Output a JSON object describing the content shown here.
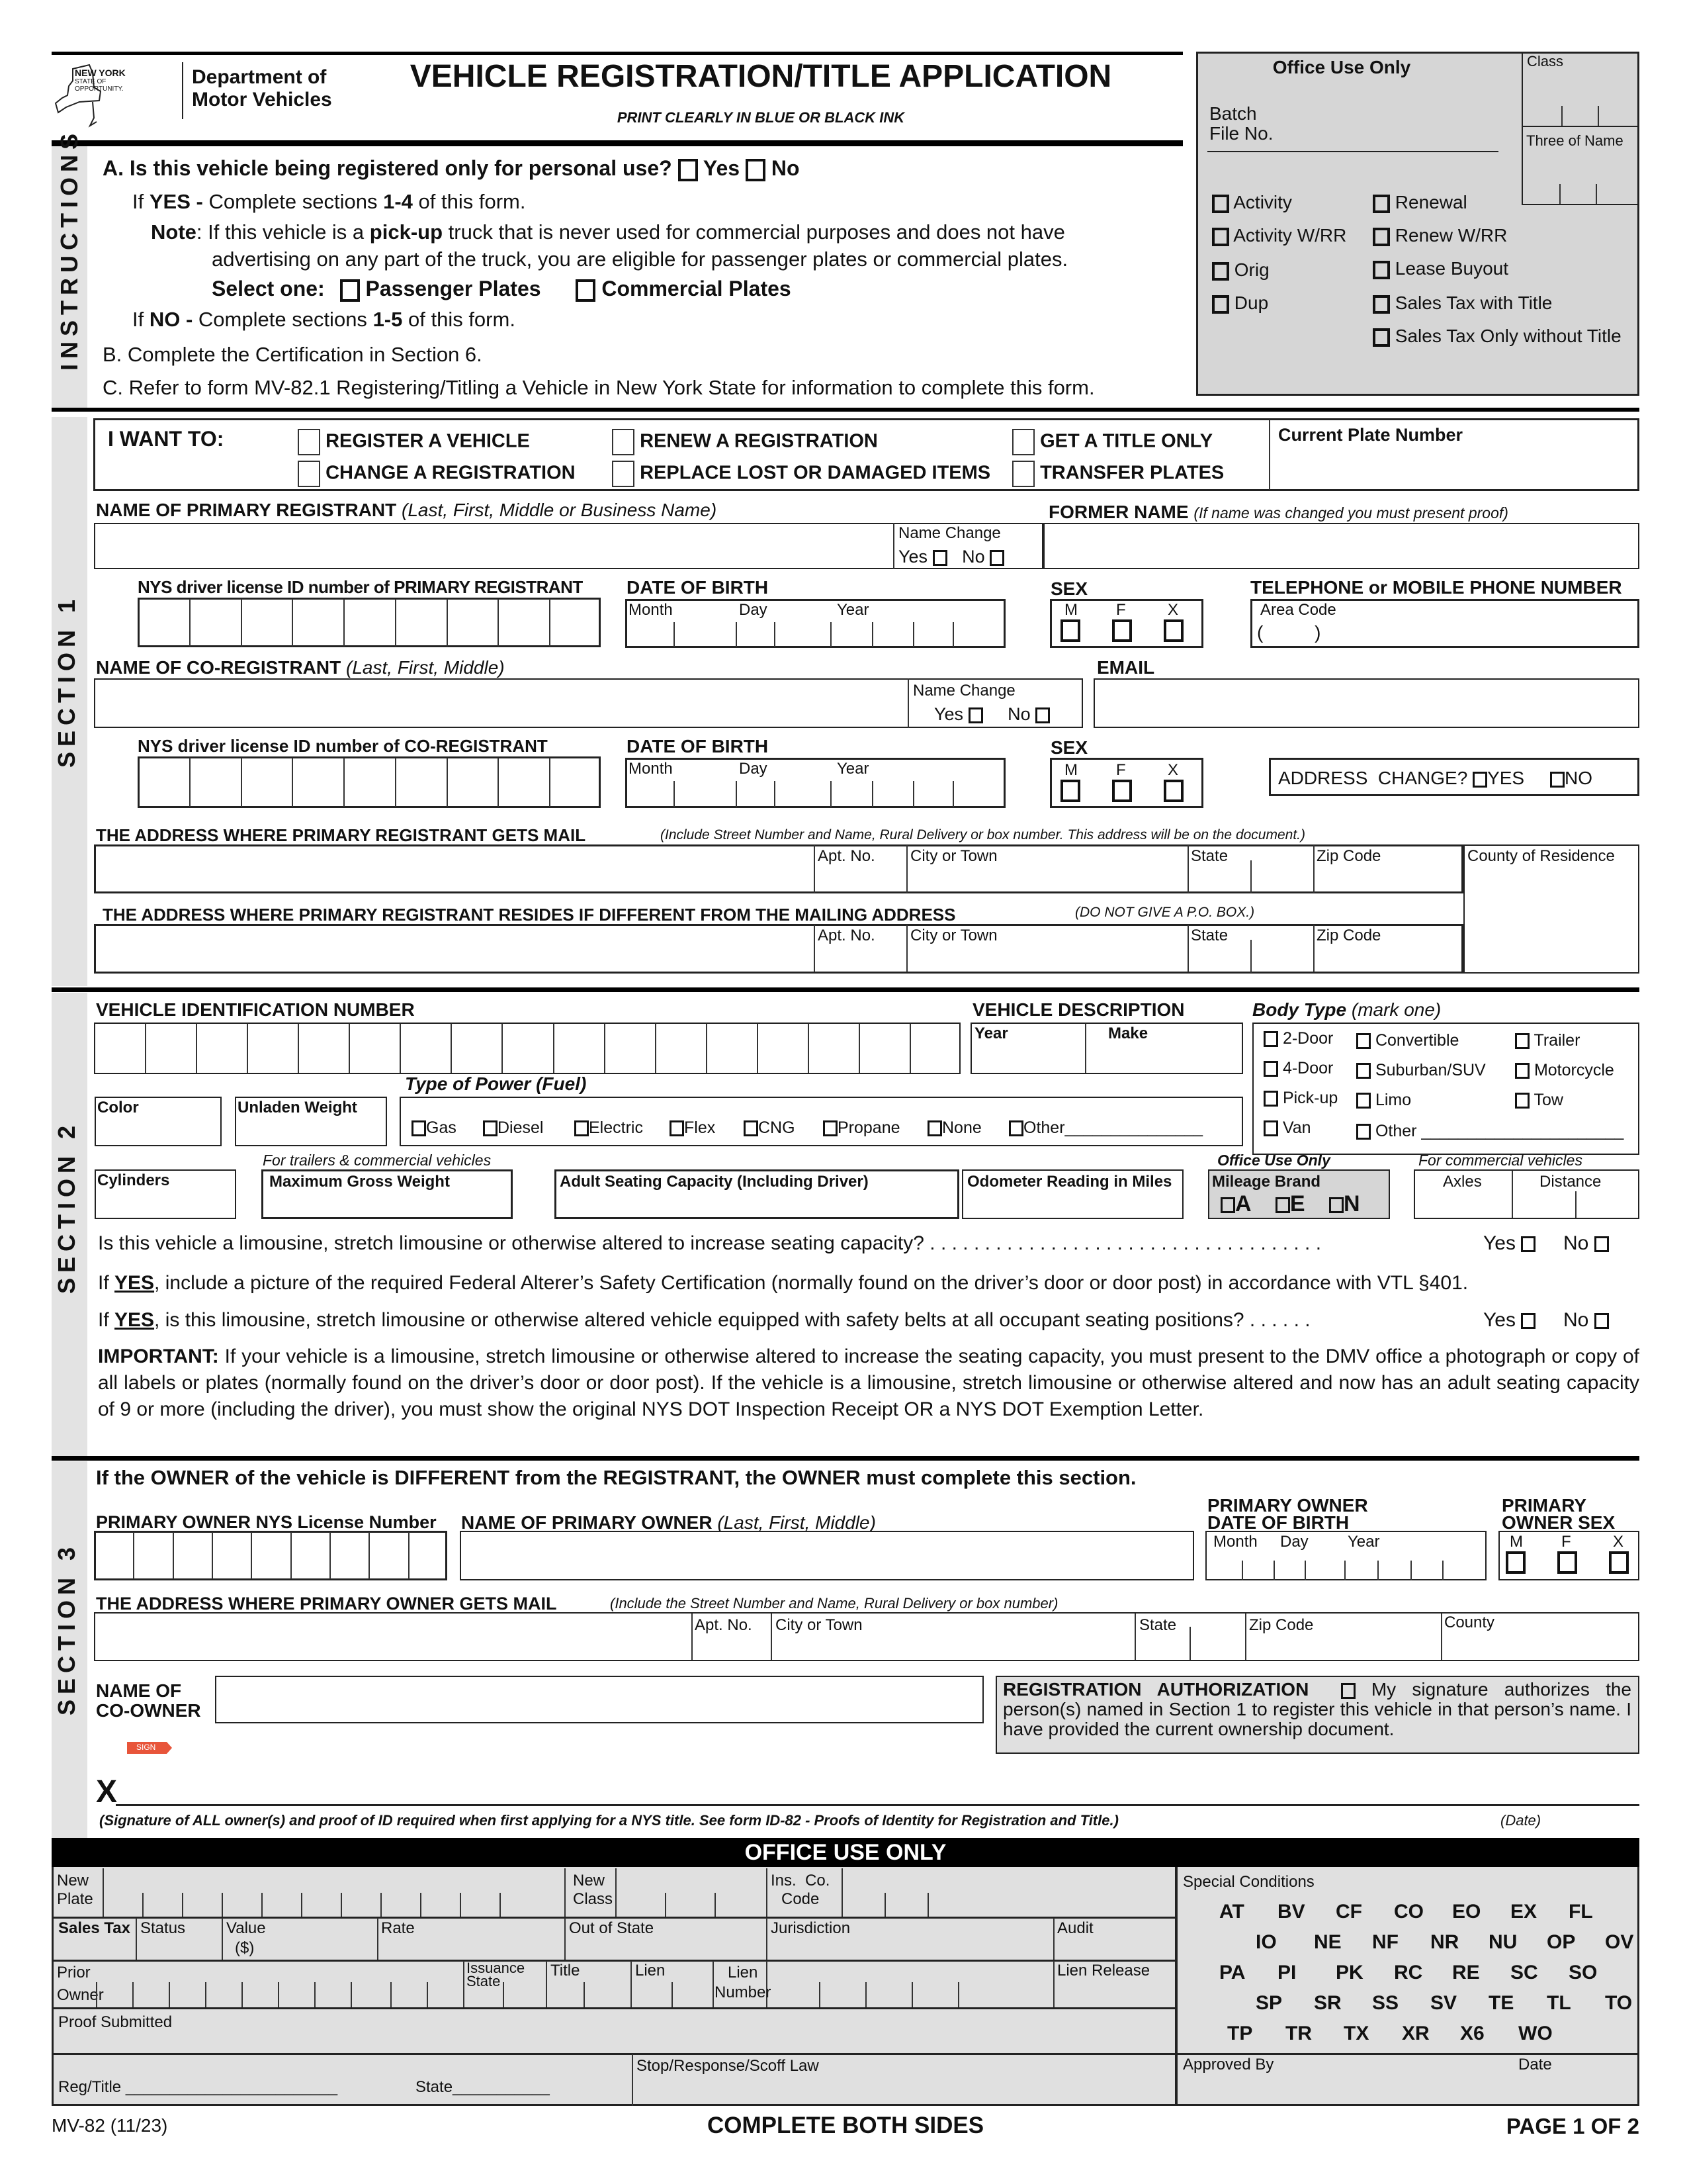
{
  "header": {
    "logo_state": "NEW YORK",
    "logo_state_sub1": "STATE OF",
    "logo_state_sub2": "OPPORTUNITY.",
    "agency_line1": "Department of",
    "agency_line2": "Motor Vehicles",
    "title": "VEHICLE REGISTRATION/TITLE APPLICATION",
    "subtitle": "PRINT CLEARLY IN BLUE OR BLACK INK"
  },
  "office_top": {
    "title": "Office Use Only",
    "batch_label": "Batch",
    "file_no_label": "File No.",
    "class_label": "Class",
    "three_of_name_label": "Three of Name",
    "left_checks": [
      "Activity",
      "Activity W/RR",
      "Orig",
      "Dup"
    ],
    "right_checks": [
      "Renewal",
      "Renew W/RR",
      "Lease Buyout",
      "Sales Tax with Title",
      "Sales Tax Only without Title"
    ]
  },
  "instructions": {
    "side_label": "INSTRUCTIONS",
    "a_question": "A. Is this vehicle being registered only for personal use?",
    "yes": "Yes",
    "no": "No",
    "if_yes_prefix": "If",
    "if_yes_bold": "YES -",
    "if_yes_text": "Complete sections",
    "if_yes_range": "1-4",
    "if_yes_suffix": "of this form.",
    "note_label": "Note",
    "note_text1": ": If this vehicle is a",
    "note_bold": "pick-up",
    "note_text2": "truck that is never used for commercial purposes and does not have",
    "note_line2": "advertising on any part of the truck, you are eligible for passenger plates or commercial plates.",
    "select_one": "Select one:",
    "passenger_plates": "Passenger Plates",
    "commercial_plates": "Commercial Plates",
    "if_no_prefix": "If",
    "if_no_bold": "NO -",
    "if_no_text": "Complete sections",
    "if_no_range": "1-5",
    "if_no_suffix": "of this form.",
    "b_text": "B. Complete the Certification in Section 6.",
    "c_text": "C. Refer to form MV-82.1 Registering/Titling a Vehicle in New York State for information to complete this form."
  },
  "section1": {
    "side_label": "SECTION 1",
    "i_want_to": "I WANT TO:",
    "options": [
      "REGISTER A VEHICLE",
      "CHANGE A REGISTRATION",
      "RENEW A REGISTRATION",
      "REPLACE LOST OR DAMAGED ITEMS",
      "GET A TITLE ONLY",
      "TRANSFER PLATES"
    ],
    "current_plate_label": "Current Plate Number",
    "primary_name_label": "NAME OF PRIMARY REGISTRANT",
    "primary_name_hint": "(Last, First, Middle or Business Name)",
    "name_change_label": "Name Change",
    "yes": "Yes",
    "no": "No",
    "former_name_label": "FORMER NAME",
    "former_name_hint": "(If name was changed you must present proof)",
    "primary_license_label": "NYS driver license ID number of PRIMARY REGISTRANT",
    "dob_label": "DATE OF BIRTH",
    "month": "Month",
    "day": "Day",
    "year": "Year",
    "sex_label": "SEX",
    "sex_options": [
      "M",
      "F",
      "X"
    ],
    "phone_label": "TELEPHONE or MOBILE PHONE NUMBER",
    "area_code_label": "Area Code",
    "area_code_parens": "(          )",
    "co_name_label": "NAME OF CO-REGISTRANT",
    "co_name_hint": "(Last, First, Middle)",
    "email_label": "EMAIL",
    "co_license_label": "NYS driver license ID number of CO-REGISTRANT",
    "address_change_label": "ADDRESS  CHANGE?",
    "address_yes": "YES",
    "address_no": "NO",
    "mail_address_label": "THE ADDRESS WHERE PRIMARY REGISTRANT GETS MAIL",
    "mail_address_hint": "(Include Street Number and Name, Rural Delivery or box number. This address will be on the document.)",
    "apt_label": "Apt. No.",
    "city_label": "City or Town",
    "state_label": "State",
    "zip_label": "Zip Code",
    "county_label": "County of Residence",
    "reside_address_label": "THE ADDRESS WHERE PRIMARY REGISTRANT RESIDES IF DIFFERENT FROM THE MAILING ADDRESS",
    "reside_address_hint": "(DO NOT GIVE A P.O. BOX.)"
  },
  "section2": {
    "side_label": "SECTION 2",
    "vin_label": "VEHICLE IDENTIFICATION NUMBER",
    "vehicle_desc_label": "VEHICLE DESCRIPTION",
    "year_label": "Year",
    "make_label": "Make",
    "body_type_label": "Body Type",
    "body_type_hint": "(mark one)",
    "body_types": [
      "2-Door",
      "4-Door",
      "Pick-up",
      "Van",
      "Convertible",
      "Suburban/SUV",
      "Limo",
      "Other ______________________",
      "Trailer",
      "Motorcycle",
      "Tow"
    ],
    "fuel_label": "Type of Power (Fuel)",
    "fuel_types": [
      "Gas",
      "Diesel",
      "Electric",
      "Flex",
      "CNG",
      "Propane",
      "None",
      "Other_______________"
    ],
    "color_label": "Color",
    "unladen_label": "Unladen Weight",
    "trailers_hint": "For trailers & commercial vehicles",
    "cylinders_label": "Cylinders",
    "max_gross_label": "Maximum Gross Weight",
    "seating_label": "Adult Seating Capacity (Including Driver)",
    "odometer_label": "Odometer Reading in Miles",
    "office_use_label": "Office Use Only",
    "mileage_brand_label": "Mileage Brand",
    "mileage_options": [
      "A",
      "E",
      "N"
    ],
    "commercial_hint": "For commercial vehicles",
    "axles_label": "Axles",
    "distance_label": "Distance",
    "limo_question": "Is this vehicle a limousine, stretch limousine or otherwise altered to increase seating capacity? . . . . . . . . . . . . . . . . . . . . . . . . . . . . . . . . . . . .",
    "yes": "Yes",
    "no": "No",
    "if_word": "If",
    "yes_caps": "YES",
    "picture_text": ", include a picture of the required Federal Alterer’s Safety Certification (normally found on the driver’s door or door post) in accordance with VTL §401.",
    "belts_text": ", is this limousine, stretch limousine or otherwise altered vehicle equipped with safety belts at all occupant seating positions? . . . . . .",
    "important_label": "IMPORTANT:",
    "important_text": "If your vehicle is a limousine, stretch limousine or otherwise altered to increase the seating capacity, you must present to the DMV office a photograph or copy of all labels or plates (normally found on the driver’s door or door post). If the vehicle is a limousine, stretch limousine or otherwise altered and now has an adult seating capacity of 9 or more (including the driver), you must show the original NYS DOT Inspection Receipt OR a NYS DOT Exemption Letter."
  },
  "section3": {
    "side_label": "SECTION 3",
    "intro": "If the OWNER of the vehicle is DIFFERENT from the REGISTRANT, the OWNER must complete this section.",
    "license_label_bold": "PRIMARY OWNER NYS",
    "license_label_rest": "License Number",
    "name_label": "NAME OF PRIMARY OWNER",
    "name_hint": "(Last, First, Middle)",
    "dob_label_line1": "PRIMARY OWNER",
    "dob_label_line2": "DATE OF BIRTH",
    "sex_label_line1": "PRIMARY",
    "sex_label_line2": "OWNER SEX",
    "month": "Month",
    "day": "Day",
    "year": "Year",
    "sex_options": [
      "M",
      "F",
      "X"
    ],
    "mail_label": "THE ADDRESS WHERE PRIMARY OWNER GETS MAIL",
    "mail_hint": "(Include the Street Number and Name, Rural Delivery or box number)",
    "apt_label": "Apt. No.",
    "city_label": "City or Town",
    "state_label": "State",
    "zip_label": "Zip Code",
    "county_label": "County",
    "co_owner_line1": "NAME OF",
    "co_owner_line2": "CO-OWNER",
    "auth_title": "REGISTRATION AUTHORIZATION",
    "auth_text1": "My signature authorizes the",
    "auth_text2": "person(s) named in Section 1 to register this vehicle in that person’s name. I have provided the current ownership document.",
    "sign_tag": "SIGN",
    "sign_x": "X",
    "signature_note": "(Signature of ALL owner(s) and proof of ID required when first applying for a NYS title. See form ID-82 - Proofs of Identity for Registration and Title.)",
    "date_label": "(Date)"
  },
  "office_bottom": {
    "title": "OFFICE USE ONLY",
    "new_plate_line1": "New",
    "new_plate_line2": "Plate",
    "new_class_line1": "New",
    "new_class_line2": "Class",
    "ins_co_line1": "Ins.  Co.",
    "ins_co_line2": "Code",
    "sales_tax": "Sales Tax",
    "status": "Status",
    "value": "Value",
    "value_unit": "($)",
    "rate": "Rate",
    "out_of_state": "Out of State",
    "jurisdiction": "Jurisdiction",
    "audit": "Audit",
    "prior_line1": "Prior",
    "prior_line2": "Owner",
    "issuance_line1": "Issuance",
    "issuance_line2": "State",
    "title_label": "Title",
    "lien": "Lien",
    "lien_number_line1": "Lien",
    "lien_number_line2": "Number",
    "lien_release": "Lien Release",
    "proof_submitted": "Proof Submitted",
    "reg_title": "Reg/Title ________________________",
    "state_line": "State___________",
    "stop_response": "Stop/Response/Scoff Law",
    "special_conditions": "Special Conditions",
    "codes_rows": [
      [
        "AT",
        "BV",
        "CF",
        "CO",
        "EO",
        "EX",
        "FL"
      ],
      [
        "IO",
        "NE",
        "NF",
        "NR",
        "NU",
        "OP",
        "OV"
      ],
      [
        "PA",
        "PI",
        "PK",
        "RC",
        "RE",
        "SC",
        "SO"
      ],
      [
        "SP",
        "SR",
        "SS",
        "SV",
        "TE",
        "TL",
        "TO"
      ],
      [
        "TP",
        "TR",
        "TX",
        "XR",
        "X6",
        "WO"
      ]
    ],
    "approved_by": "Approved By",
    "date": "Date"
  },
  "footer": {
    "form_id": "MV-82 (11/23)",
    "complete_both": "COMPLETE BOTH SIDES",
    "page": "PAGE 1 OF 2"
  },
  "colors": {
    "sign_tag": "#e8553a",
    "office_grey": "#d6d6d6",
    "sidebar_grey": "#e3e3e3"
  }
}
